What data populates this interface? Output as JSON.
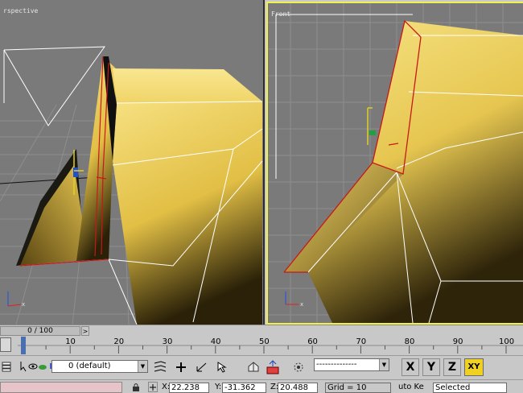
{
  "viewports": {
    "perspective": {
      "label": "rspective"
    },
    "front": {
      "label": "Front"
    }
  },
  "time_slider": {
    "frame_text": "0 / 100",
    "next_glyph": ">"
  },
  "trackbar": {
    "tick_labels": [
      "10",
      "20",
      "30",
      "40",
      "50",
      "60",
      "70",
      "80",
      "90",
      "100"
    ]
  },
  "toolbar": {
    "layer_value": "0 (default)",
    "selection_filter_value": "--------------",
    "axis_buttons": [
      "X",
      "Y",
      "Z",
      "XY"
    ],
    "active_axis": "XY"
  },
  "status": {
    "x_label": "X:",
    "x_value": "22.238",
    "y_label": "Y:",
    "y_value": "-31.362",
    "z_label": "Z:",
    "z_value": "20.488",
    "grid_text": "Grid = 10",
    "autokey_text": "uto Ke",
    "selected_value": "Selected"
  },
  "colors": {
    "mesh": "#f2d060",
    "active_border": "#f0f050",
    "viewport_bg": "#7a7a7a"
  }
}
